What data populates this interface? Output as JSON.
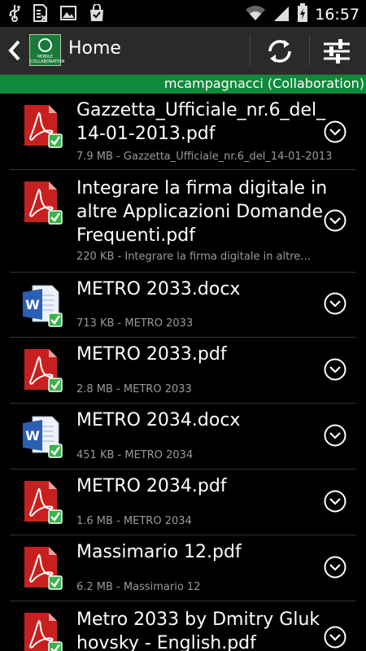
{
  "status_bar": {
    "time": "16:57",
    "icons": [
      "usb-icon",
      "sim-icon",
      "image-icon",
      "shopping-bag-icon",
      "wifi-icon",
      "signal-icon",
      "battery-charging-icon"
    ]
  },
  "action_bar": {
    "title": "Home",
    "logo_text": "MOBILE COLLABORATION",
    "icons": [
      "back-arrow-icon",
      "refresh-icon",
      "settings-sliders-icon"
    ]
  },
  "account": {
    "label": "mcampagnacci (Collaboration)",
    "color": "#0f8a3a"
  },
  "files": [
    {
      "name": "Gazzetta_Ufficiale_nr.6_del_14-01-2013.pdf",
      "size": "7.9 MB",
      "desc": "Gazzetta_Ufficiale_nr.6_del_14-01-2013",
      "type": "pdf"
    },
    {
      "name": "Integrare la firma digitale in altre Applicazioni Domande Frequenti.pdf",
      "size": "220 KB",
      "desc": "Integrare la firma digitale in altre…",
      "type": "pdf"
    },
    {
      "name": "METRO 2033.docx",
      "size": "713 KB",
      "desc": "METRO 2033",
      "type": "docx"
    },
    {
      "name": "METRO 2033.pdf",
      "size": "2.8 MB",
      "desc": "METRO 2033",
      "type": "pdf"
    },
    {
      "name": "METRO 2034.docx",
      "size": "451 KB",
      "desc": "METRO 2034",
      "type": "docx"
    },
    {
      "name": "METRO 2034.pdf",
      "size": "1.6 MB",
      "desc": "METRO 2034",
      "type": "pdf"
    },
    {
      "name": "Massimario 12.pdf",
      "size": "6.2 MB",
      "desc": "Massimario 12",
      "type": "pdf"
    },
    {
      "name": "Metro 2033 by Dmitry Glukhovsky - English.pdf",
      "size": "",
      "desc": "",
      "type": "pdf"
    }
  ],
  "colors": {
    "pdf_red": "#c8201f",
    "word_blue": "#2b5fb4",
    "sync_green": "#36b44a"
  }
}
